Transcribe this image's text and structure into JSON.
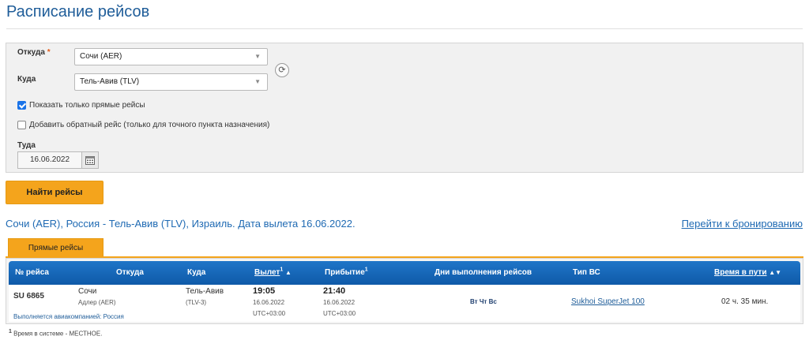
{
  "page_title": "Расписание рейсов",
  "form": {
    "from_label": "Откуда",
    "required_mark": "*",
    "from_value": "Сочи (AER)",
    "to_label": "Куда",
    "to_value": "Тель-Авив (TLV)",
    "direct_only_label": "Показать только прямые рейсы",
    "direct_only_checked": true,
    "return_label": "Добавить обратный рейс (только для точного пункта назначения)",
    "return_checked": false,
    "date_label": "Туда",
    "date_value": "16.06.2022",
    "search_button": "Найти рейсы"
  },
  "results": {
    "route_title": "Сочи (AER), Россия - Тель-Авив (TLV), Израиль. Дата вылета 16.06.2022.",
    "booking_link": "Перейти к бронированию",
    "tab_direct": "Прямые рейсы",
    "columns": {
      "flight_no": "№ рейса",
      "from": "Откуда",
      "to": "Куда",
      "departure": "Вылет",
      "arrival": "Прибытие",
      "days": "Дни выполнения рейсов",
      "aircraft": "Тип ВС",
      "duration": "Время в пути",
      "footnote_mark": "1",
      "sort_up": "▲",
      "sort_both": "▲▼"
    },
    "rows": [
      {
        "flight_no": "SU 6865",
        "from_city": "Сочи",
        "from_airport": "Адлер (AER)",
        "to_city": "Тель-Авив",
        "to_airport": "(TLV-3)",
        "dep_time": "19:05",
        "dep_date": "16.06.2022",
        "dep_tz": "UTC+03:00",
        "arr_time": "21:40",
        "arr_date": "16.06.2022",
        "arr_tz": "UTC+03:00",
        "days": "Вт Чт Вс",
        "aircraft": "Sukhoi SuperJet 100",
        "duration": "02 ч. 35 мин.",
        "operated_by": "Выполняется авиакомпанией: Россия"
      }
    ]
  },
  "footnote": {
    "mark": "1",
    "text": "Время в системе - МЕСТНОЕ."
  },
  "icons": {
    "swap": "swap-icon",
    "calendar": "calendar-icon",
    "dropdown": "chevron-down-icon"
  },
  "colors": {
    "accent_orange": "#f4a41c",
    "header_blue": "#1f75c8",
    "link_blue": "#1f6ab3",
    "title_blue": "#1f5d99"
  }
}
